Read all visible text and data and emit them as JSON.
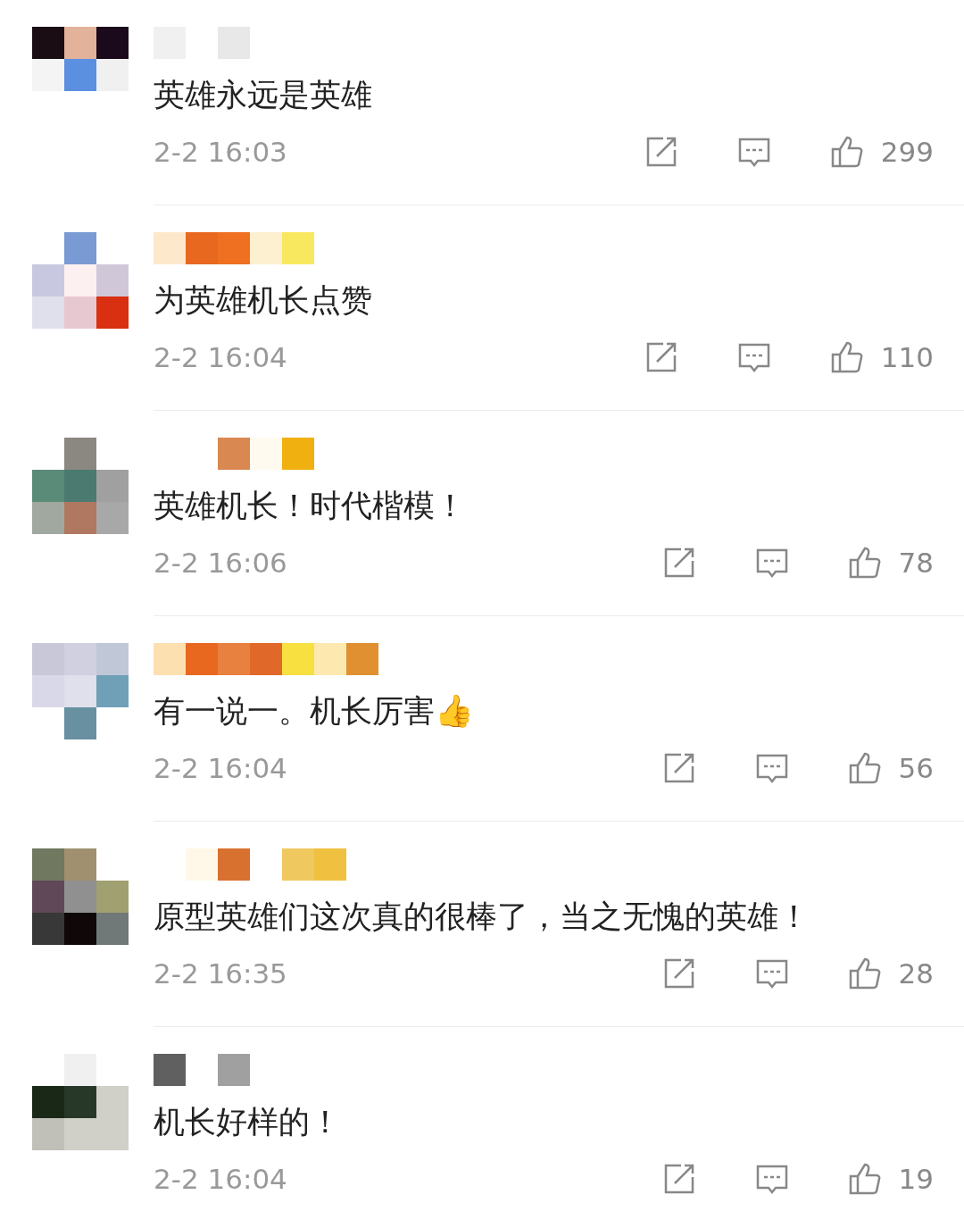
{
  "comments": [
    {
      "text": "英雄永远是英雄",
      "time": "2-2 16:03",
      "likes": "299"
    },
    {
      "text": "为英雄机长点赞",
      "time": "2-2 16:04",
      "likes": "110"
    },
    {
      "text": "英雄机长！时代楷模！",
      "time": "2-2 16:06",
      "likes": "78"
    },
    {
      "text": "有一说一。机长厉害👍",
      "time": "2-2 16:04",
      "likes": "56"
    },
    {
      "text": "原型英雄们这次真的很棒了，当之无愧的英雄！",
      "time": "2-2 16:35",
      "likes": "28"
    },
    {
      "text": "机长好样的！",
      "time": "2-2 16:04",
      "likes": "19"
    }
  ]
}
